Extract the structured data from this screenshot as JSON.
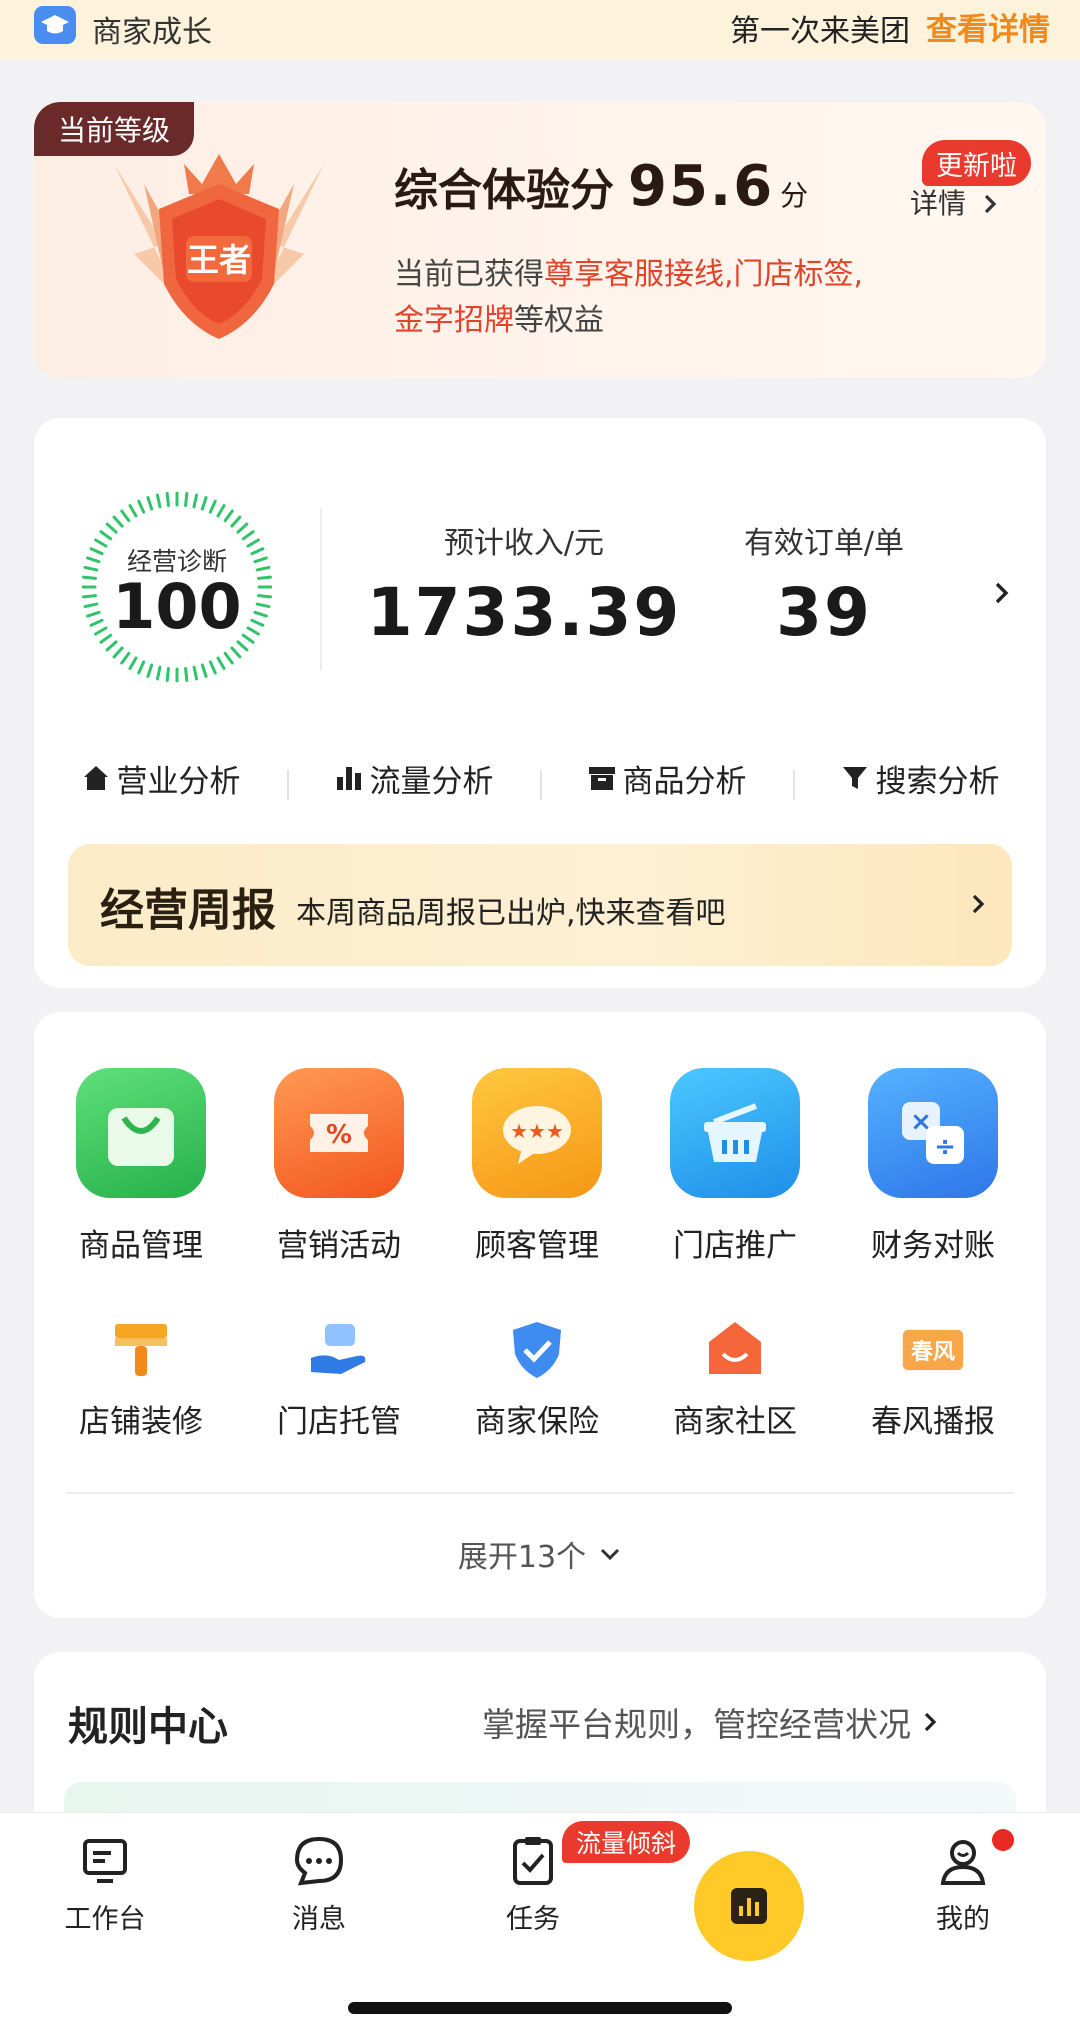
{
  "topbar": {
    "title": "商家成长",
    "marquee": "第一次来美团",
    "detail_link": "查看详情"
  },
  "level": {
    "tag": "当前等级",
    "badge_text": "王者",
    "score_label": "综合体验分",
    "score": "95.6",
    "score_unit": "分",
    "update_badge": "更新啦",
    "detail": "详情",
    "benefit_prefix": "当前已获得",
    "benefit_hl1": "尊享客服接线,门店标签,",
    "benefit_hl2": "金字招牌",
    "benefit_suffix": "等权益"
  },
  "stats": {
    "diagnosis_label": "经营诊断",
    "diagnosis_score": "100",
    "income_label": "预计收入/元",
    "income_value": "1733.39",
    "orders_label": "有效订单/单",
    "orders_value": "39",
    "analysis": [
      {
        "label": "营业分析",
        "icon": "home-icon"
      },
      {
        "label": "流量分析",
        "icon": "bar-chart-icon"
      },
      {
        "label": "商品分析",
        "icon": "box-icon"
      },
      {
        "label": "搜索分析",
        "icon": "funnel-icon"
      }
    ],
    "weekly_title": "经营周报",
    "weekly_desc": "本周商品周报已出炉,快来查看吧"
  },
  "tools": {
    "main": [
      {
        "label": "商品管理",
        "icon": "shopping-bag-icon",
        "color": "#37c25a"
      },
      {
        "label": "营销活动",
        "icon": "coupon-icon",
        "color": "#f56b2a"
      },
      {
        "label": "顾客管理",
        "icon": "chat-stars-icon",
        "color": "#f5a623"
      },
      {
        "label": "门店推广",
        "icon": "basket-icon",
        "color": "#2aa6f0"
      },
      {
        "label": "财务对账",
        "icon": "calculator-icon",
        "color": "#3a8ef2"
      }
    ],
    "secondary": [
      {
        "label": "店铺装修",
        "icon": "paint-brush-icon"
      },
      {
        "label": "门店托管",
        "icon": "hand-icon"
      },
      {
        "label": "商家保险",
        "icon": "shield-check-icon"
      },
      {
        "label": "商家社区",
        "icon": "community-icon"
      },
      {
        "label": "春风播报",
        "icon": "chunfeng-icon",
        "icon_text": "春风"
      }
    ],
    "expand": "展开13个"
  },
  "rules": {
    "title": "规则中心",
    "subtitle": "掌握平台规则，管控经营状况"
  },
  "tabbar": {
    "items": [
      {
        "label": "工作台",
        "icon": "workbench-icon"
      },
      {
        "label": "消息",
        "icon": "message-icon"
      },
      {
        "label": "任务",
        "icon": "task-icon"
      },
      {
        "label": "我的",
        "icon": "profile-icon"
      }
    ],
    "task_badge": "流量倾斜"
  }
}
